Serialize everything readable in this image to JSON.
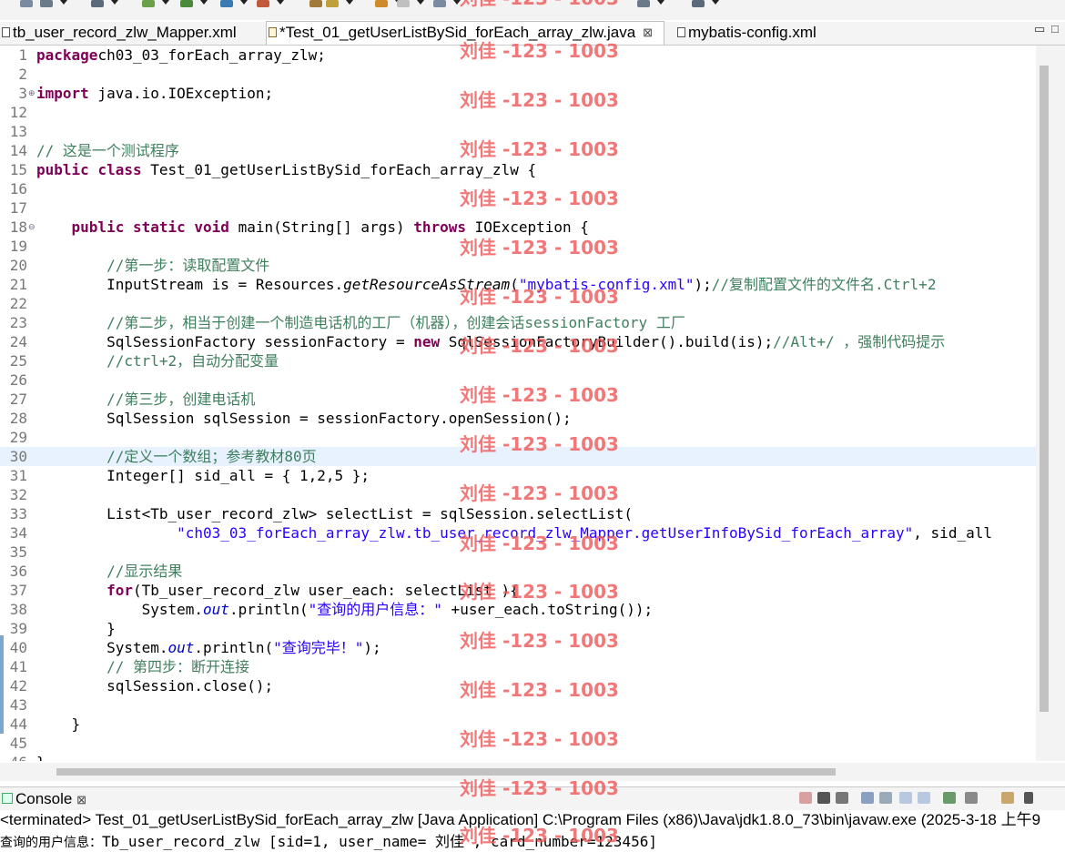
{
  "tabs": [
    {
      "label": "tb_user_record_zlw_Mapper.xml",
      "active": false
    },
    {
      "label": "*Test_01_getUserListBySid_forEach_array_zlw.java",
      "active": true,
      "close": "⊠"
    },
    {
      "label": "mybatis-config.xml",
      "active": false
    }
  ],
  "window_controls": {
    "minimize": "▭",
    "maximize": "□"
  },
  "editor": {
    "lines": [
      {
        "n": "1",
        "segs": [
          [
            "kw",
            "package"
          ],
          [
            "",
            "ch03_03_forEach_array_zlw;"
          ]
        ]
      },
      {
        "n": "2",
        "segs": []
      },
      {
        "n": "3",
        "segs": [
          [
            "kw",
            "import"
          ],
          [
            "",
            " java.io.IOException;"
          ]
        ],
        "fold": "⊕"
      },
      {
        "n": "12",
        "segs": []
      },
      {
        "n": "13",
        "segs": []
      },
      {
        "n": "14",
        "segs": [
          [
            "cm",
            "// 这是一个测试程序"
          ]
        ]
      },
      {
        "n": "15",
        "segs": [
          [
            "kw",
            "public"
          ],
          [
            "",
            " "
          ],
          [
            "kw",
            "class"
          ],
          [
            "",
            " Test_01_getUserListBySid_forEach_array_zlw {"
          ]
        ]
      },
      {
        "n": "16",
        "segs": []
      },
      {
        "n": "17",
        "segs": []
      },
      {
        "n": "18",
        "segs": [
          [
            "",
            "    "
          ],
          [
            "kw",
            "public"
          ],
          [
            "",
            " "
          ],
          [
            "kw",
            "static"
          ],
          [
            "",
            " "
          ],
          [
            "kw",
            "void"
          ],
          [
            "",
            " main(String[] args) "
          ],
          [
            "kw",
            "throws"
          ],
          [
            "",
            " IOException {"
          ]
        ],
        "fold": "⊖"
      },
      {
        "n": "19",
        "segs": []
      },
      {
        "n": "20",
        "segs": [
          [
            "",
            "        "
          ],
          [
            "cm",
            "//第一步：读取配置文件"
          ]
        ]
      },
      {
        "n": "21",
        "segs": [
          [
            "",
            "        InputStream is = Resources."
          ],
          [
            "it",
            "getResourceAsStream"
          ],
          [
            "",
            "("
          ],
          [
            "str",
            "\"mybatis-config.xml\""
          ],
          [
            "",
            ");"
          ],
          [
            "cm",
            "//复制配置文件的文件名.Ctrl+2"
          ]
        ]
      },
      {
        "n": "22",
        "segs": []
      },
      {
        "n": "23",
        "segs": [
          [
            "",
            "        "
          ],
          [
            "cm",
            "//第二步，相当于创建一个制造电话机的工厂（机器），创建会话sessionFactory 工厂"
          ]
        ]
      },
      {
        "n": "24",
        "segs": [
          [
            "",
            "        SqlSessionFactory sessionFactory = "
          ],
          [
            "kw",
            "new"
          ],
          [
            "",
            " SqlSessionFactoryBuilder().build(is);"
          ],
          [
            "cm",
            "//Alt+/ ，强制代码提示"
          ]
        ]
      },
      {
        "n": "25",
        "segs": [
          [
            "",
            "        "
          ],
          [
            "cm",
            "//ctrl+2，自动分配变量"
          ]
        ]
      },
      {
        "n": "26",
        "segs": []
      },
      {
        "n": "27",
        "segs": [
          [
            "",
            "        "
          ],
          [
            "cm",
            "//第三步，创建电话机"
          ]
        ]
      },
      {
        "n": "28",
        "segs": [
          [
            "",
            "        SqlSession sqlSession = sessionFactory.openSession();"
          ]
        ]
      },
      {
        "n": "29",
        "segs": []
      },
      {
        "n": "30",
        "segs": [
          [
            "",
            "        "
          ],
          [
            "cm",
            "//定义一个数组；参考教材80页"
          ]
        ],
        "current": true
      },
      {
        "n": "31",
        "segs": [
          [
            "",
            "        Integer[] sid_all = { 1,2,5 };"
          ]
        ]
      },
      {
        "n": "32",
        "segs": []
      },
      {
        "n": "33",
        "segs": [
          [
            "",
            "        List<Tb_user_record_zlw> selectList = sqlSession.selectList("
          ]
        ]
      },
      {
        "n": "34",
        "segs": [
          [
            "",
            "                "
          ],
          [
            "str",
            "\"ch03_03_forEach_array_zlw.tb_user_record_zlw_Mapper.getUserInfoBySid_forEach_array\""
          ],
          [
            "",
            ", sid_all"
          ]
        ]
      },
      {
        "n": "35",
        "segs": []
      },
      {
        "n": "36",
        "segs": [
          [
            "",
            "        "
          ],
          [
            "cm",
            "//显示结果"
          ]
        ]
      },
      {
        "n": "37",
        "segs": [
          [
            "",
            "        "
          ],
          [
            "kw",
            "for"
          ],
          [
            "",
            "(Tb_user_record_zlw user_each: selectList ){"
          ]
        ]
      },
      {
        "n": "38",
        "segs": [
          [
            "",
            "            System."
          ],
          [
            "st",
            "out"
          ],
          [
            "",
            ".println("
          ],
          [
            "str",
            "\"查询的用户信息：\""
          ],
          [
            "",
            " +user_each.toString());"
          ]
        ]
      },
      {
        "n": "39",
        "segs": [
          [
            "",
            "        }"
          ]
        ]
      },
      {
        "n": "40",
        "segs": [
          [
            "",
            "        System."
          ],
          [
            "st",
            "out"
          ],
          [
            "",
            ".println("
          ],
          [
            "str",
            "\"查询完毕！\""
          ],
          [
            "",
            ");"
          ]
        ]
      },
      {
        "n": "41",
        "segs": [
          [
            "",
            "        "
          ],
          [
            "cm",
            "// 第四步：断开连接"
          ]
        ]
      },
      {
        "n": "42",
        "segs": [
          [
            "",
            "        sqlSession.close();"
          ]
        ]
      },
      {
        "n": "43",
        "segs": []
      },
      {
        "n": "44",
        "segs": [
          [
            "",
            "    }"
          ]
        ]
      },
      {
        "n": "45",
        "segs": []
      },
      {
        "n": "46",
        "segs": [
          [
            "",
            "}"
          ]
        ]
      }
    ]
  },
  "watermark": "刘佳 -123 - 1003",
  "console": {
    "tab_label": "Console",
    "tab_close": "⊠",
    "status": "<terminated> Test_01_getUserListBySid_forEach_array_zlw [Java Application] C:\\Program Files (x86)\\Java\\jdk1.8.0_73\\bin\\javaw.exe (2025-3-18 上午9",
    "output_prefix": "查询的用户信息：",
    "output_rest": "Tb_user_record_zlw [sid=1, user_name= 刘佳 , card_number=123456]"
  }
}
